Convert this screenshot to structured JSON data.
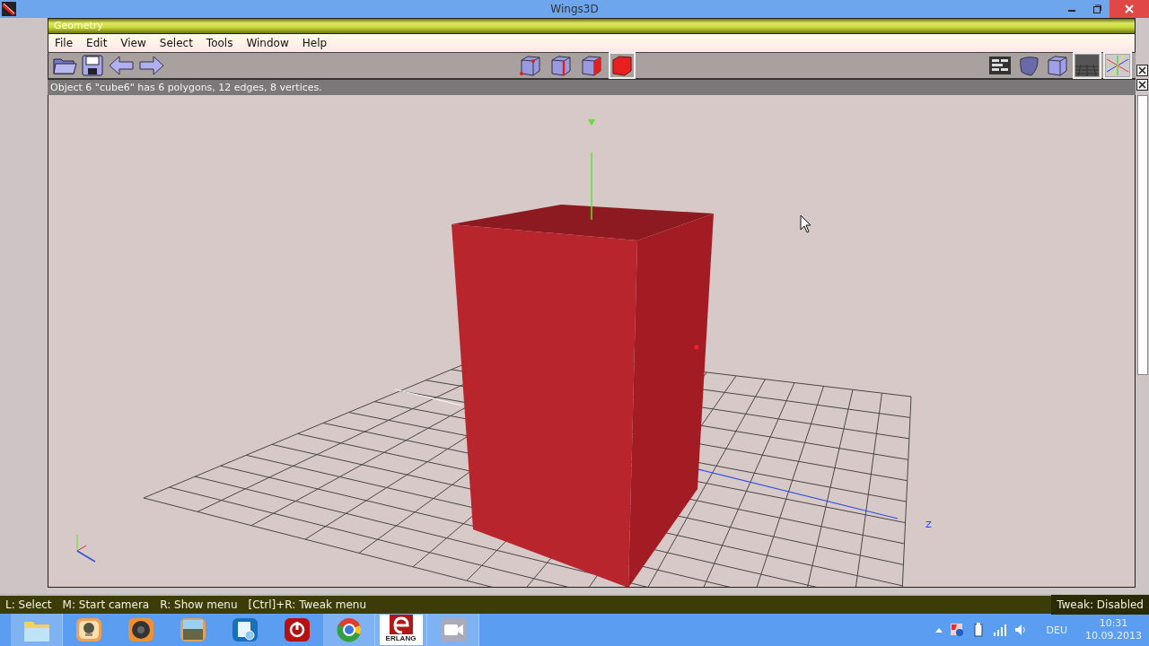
{
  "window": {
    "title": "Wings3D"
  },
  "geometry_window": {
    "title": "Geometry"
  },
  "menu": [
    {
      "label": "File"
    },
    {
      "label": "Edit"
    },
    {
      "label": "View"
    },
    {
      "label": "Select"
    },
    {
      "label": "Tools"
    },
    {
      "label": "Window"
    },
    {
      "label": "Help"
    }
  ],
  "toolbar": {
    "file_buttons": [
      {
        "kind": "open"
      },
      {
        "kind": "save"
      },
      {
        "kind": "undo"
      },
      {
        "kind": "redo"
      }
    ],
    "selection_modes": [
      {
        "kind": "vertex",
        "selected": false
      },
      {
        "kind": "edge",
        "selected": false
      },
      {
        "kind": "face",
        "selected": false
      },
      {
        "kind": "body",
        "selected": true
      }
    ],
    "view_buttons": [
      {
        "kind": "outliner",
        "on": false
      },
      {
        "kind": "smooth",
        "on": false
      },
      {
        "kind": "flat",
        "on": false
      },
      {
        "kind": "groundplane",
        "on": true
      },
      {
        "kind": "axes",
        "on": true
      }
    ]
  },
  "info": "Object 6 \"cube6\" has 6 polygons, 12 edges, 8 vertices.",
  "viewport": {
    "axis_label": "z"
  },
  "status_bar": {
    "hints": [
      "L: Select",
      "M: Start camera",
      "R: Show menu",
      "[Ctrl]+R: Tweak menu"
    ],
    "tweak": "Tweak: Disabled"
  },
  "taskbar": {
    "apps": [
      {
        "kind": "folder",
        "running": true
      },
      {
        "kind": "webcam",
        "running": false
      },
      {
        "kind": "speaker",
        "running": false
      },
      {
        "kind": "docs",
        "running": false
      },
      {
        "kind": "settings",
        "running": false
      },
      {
        "kind": "power",
        "running": false
      },
      {
        "kind": "browser",
        "running": true
      },
      {
        "kind": "erlang",
        "label": "ERLANG",
        "running": true
      },
      {
        "kind": "camera",
        "running": true
      }
    ],
    "tray": {
      "language": "DEU",
      "time": "10:31",
      "date": "10.09.2013"
    }
  }
}
